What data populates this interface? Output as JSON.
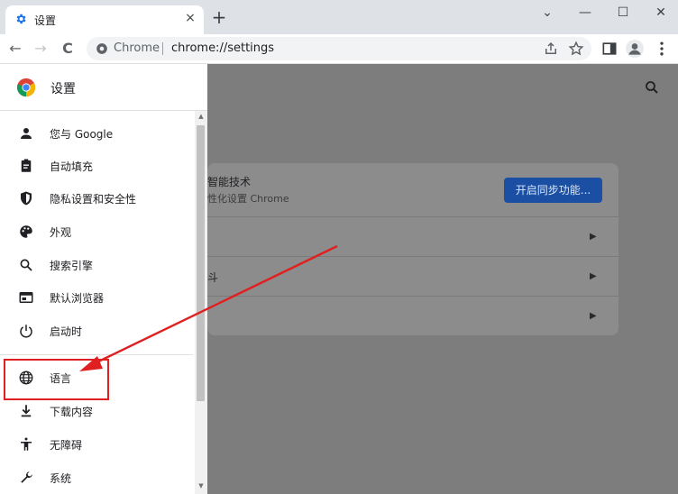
{
  "tab": {
    "title": "设置",
    "close": "×",
    "new": "+"
  },
  "window": {
    "minimize": "—",
    "maximize": "☐",
    "close": "✕",
    "collapse": "⌄"
  },
  "toolbar": {
    "back": "←",
    "forward": "→",
    "reload": "C"
  },
  "omnibox": {
    "label": "Chrome",
    "url": "chrome://settings"
  },
  "drawer": {
    "title": "设置",
    "items": [
      {
        "label": "您与 Google",
        "icon": "person-icon"
      },
      {
        "label": "自动填充",
        "icon": "clipboard-icon"
      },
      {
        "label": "隐私设置和安全性",
        "icon": "shield-icon"
      },
      {
        "label": "外观",
        "icon": "palette-icon"
      },
      {
        "label": "搜索引擎",
        "icon": "search-icon"
      },
      {
        "label": "默认浏览器",
        "icon": "browser-icon"
      },
      {
        "label": "启动时",
        "icon": "power-icon"
      },
      {
        "label": "语言",
        "icon": "globe-icon"
      },
      {
        "label": "下载内容",
        "icon": "download-icon"
      },
      {
        "label": "无障碍",
        "icon": "accessibility-icon"
      },
      {
        "label": "系统",
        "icon": "wrench-icon"
      }
    ]
  },
  "card": {
    "title_fragment": "智能技术",
    "subtitle_fragment": "性化设置 Chrome",
    "sync_button": "开启同步功能...",
    "row2_fragment": "斗"
  },
  "colors": {
    "highlight": "#e02020",
    "accent": "#1a73e8"
  }
}
